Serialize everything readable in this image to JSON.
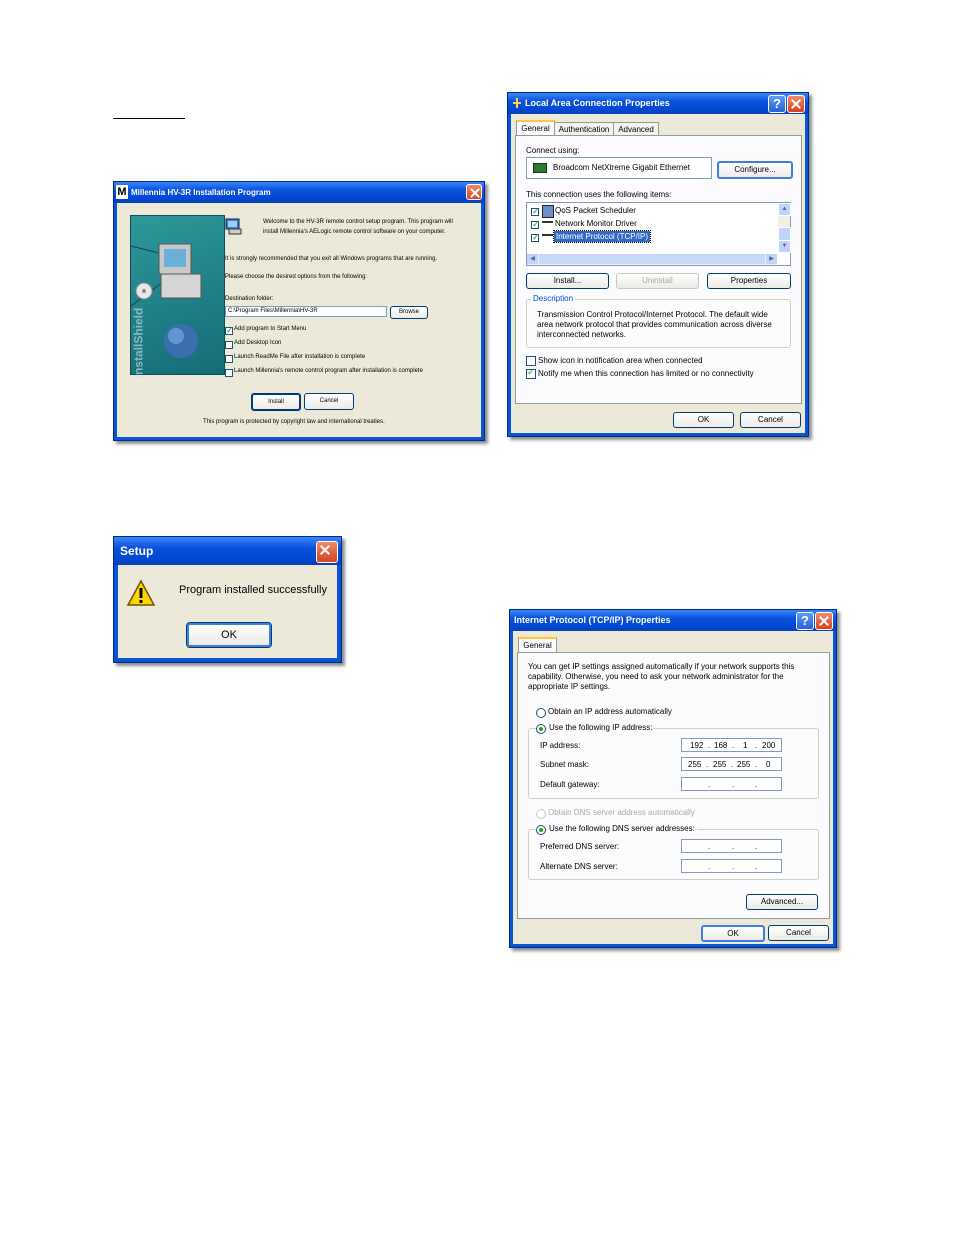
{
  "installer": {
    "title": "Millennia HV-3R Installation Program",
    "logo_letter": "M",
    "welcome_text": "Welcome to the HV-3R remote control setup program. This program will install Millennia's AELogic remote control software on your computer.",
    "recommend_text": "It is strongly recommended that you exit all Windows programs that are running.",
    "choose_text": "Please choose the desired options from the following:",
    "dest_label": "Destination folder:",
    "dest_value": "C:\\Program Files\\Millennia\\HV-3R",
    "browse_label": "Browse",
    "options": [
      {
        "label": "Add program to Start Menu",
        "checked": true
      },
      {
        "label": "Add Desktop Icon",
        "checked": false
      },
      {
        "label": "Launch ReadMe File after installation is complete",
        "checked": false
      },
      {
        "label": "Launch Millennia's remote control program after installation is complete",
        "checked": false
      }
    ],
    "install_label": "Install",
    "cancel_label": "Cancel",
    "copyright": "This program is protected by copyright law and international treaties.",
    "side_text": "InstallShield"
  },
  "lan": {
    "title": "Local Area Connection Properties",
    "tabs": [
      "General",
      "Authentication",
      "Advanced"
    ],
    "connect_using_label": "Connect using:",
    "adapter": "Broadcom NetXtreme Gigabit Ethernet",
    "configure_label": "Configure...",
    "items_label": "This connection uses the following items:",
    "items": [
      {
        "label": "QoS Packet Scheduler",
        "checked": true
      },
      {
        "label": "Network Monitor Driver",
        "checked": true
      },
      {
        "label": "Internet Protocol (TCP/IP)",
        "checked": true,
        "selected": true
      }
    ],
    "install_label": "Install...",
    "uninstall_label": "Uninstall",
    "properties_label": "Properties",
    "description_label": "Description",
    "description_text": "Transmission Control Protocol/Internet Protocol. The default wide area network protocol that provides communication across diverse interconnected networks.",
    "show_icon_label": "Show icon in notification area when connected",
    "notify_label": "Notify me when this connection has limited or no connectivity",
    "ok_label": "OK",
    "cancel_label": "Cancel"
  },
  "setup": {
    "title": "Setup",
    "message": "Program installed successfully",
    "ok_label": "OK"
  },
  "tcpip": {
    "title": "Internet Protocol (TCP/IP) Properties",
    "tab": "General",
    "intro": "You can get IP settings assigned automatically if your network supports this capability. Otherwise, you need to ask your network administrator for the appropriate IP settings.",
    "obtain_ip_label": "Obtain an IP address automatically",
    "use_ip_label": "Use the following IP address:",
    "ip_label": "IP address:",
    "ip": [
      "192",
      "168",
      "1",
      "200"
    ],
    "mask_label": "Subnet mask:",
    "mask": [
      "255",
      "255",
      "255",
      "0"
    ],
    "gateway_label": "Default gateway:",
    "obtain_dns_label": "Obtain DNS server address automatically",
    "use_dns_label": "Use the following DNS server addresses:",
    "pref_dns_label": "Preferred DNS server:",
    "alt_dns_label": "Alternate DNS server:",
    "advanced_label": "Advanced...",
    "ok_label": "OK",
    "cancel_label": "Cancel"
  }
}
